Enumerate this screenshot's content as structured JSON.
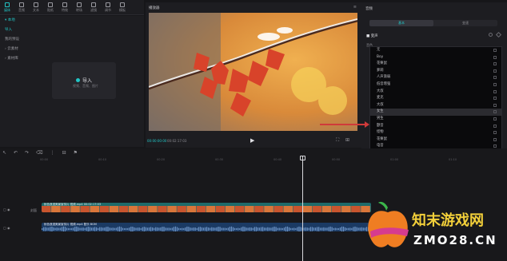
{
  "toolbar": {
    "items": [
      {
        "label": "媒体",
        "icon": "media-icon",
        "active": true
      },
      {
        "label": "音频",
        "icon": "audio-icon"
      },
      {
        "label": "文本",
        "icon": "text-icon"
      },
      {
        "label": "贴纸",
        "icon": "sticker-icon"
      },
      {
        "label": "特效",
        "icon": "effects-icon"
      },
      {
        "label": "转场",
        "icon": "transition-icon"
      },
      {
        "label": "滤镜",
        "icon": "filter-icon"
      },
      {
        "label": "调节",
        "icon": "adjust-icon"
      },
      {
        "label": "模板",
        "icon": "template-icon"
      }
    ]
  },
  "sidenav": {
    "items": [
      {
        "label": "▾ 本地",
        "active": true
      },
      {
        "label": "导入",
        "active": true
      },
      {
        "label": "我的预设"
      },
      {
        "label": "› 云素材"
      },
      {
        "label": "› 素材库"
      }
    ]
  },
  "import_box": {
    "label": "导入",
    "hint": "视频、音频、图片"
  },
  "player": {
    "title": "播放器",
    "time_current": "00:00:00:00",
    "time_total": "00:02:17:03"
  },
  "props": {
    "title": "音频",
    "tabs": [
      {
        "label": "基本",
        "active": true
      },
      {
        "label": "变速"
      }
    ],
    "section": "■ 变声",
    "section_label": "音色"
  },
  "voice_menu": {
    "items": [
      "无",
      "Boy",
      "花栗鼠",
      "萝莉",
      "人声渐弱",
      "低音增强",
      "大叔",
      "麦克",
      "大叔",
      "女生",
      "男生",
      "颤音",
      "怪物",
      "花栗鼠",
      "电音",
      "机器人",
      "合成器",
      "扩音",
      "回音",
      "高音"
    ],
    "selected_index": 9
  },
  "timeline": {
    "tool_icons": [
      "↖",
      "↶",
      "↷",
      "⌫",
      "⋮",
      "⊟",
      "⚑"
    ],
    "ruler_ticks": [
      "00:00",
      "00:10",
      "00:20",
      "00:30",
      "00:40",
      "00:50",
      "01:00",
      "01:10",
      "01:20"
    ],
    "video_track_label": "秋色浪漫美景宣传片 视频.mp4  00:02:17:03",
    "audio_track_label": "秋色浪漫美景宣传片 视频.mp4  配乐 BGM",
    "cover_label": "封面"
  },
  "watermark": {
    "logo_text": "知末游戏网",
    "domain": "ZMO28.CN"
  },
  "colors": {
    "accent": "#22c5c5",
    "video_track": "#1e6a6a",
    "audio_track": "#1b3a63",
    "arrow": "#d03a3a"
  }
}
